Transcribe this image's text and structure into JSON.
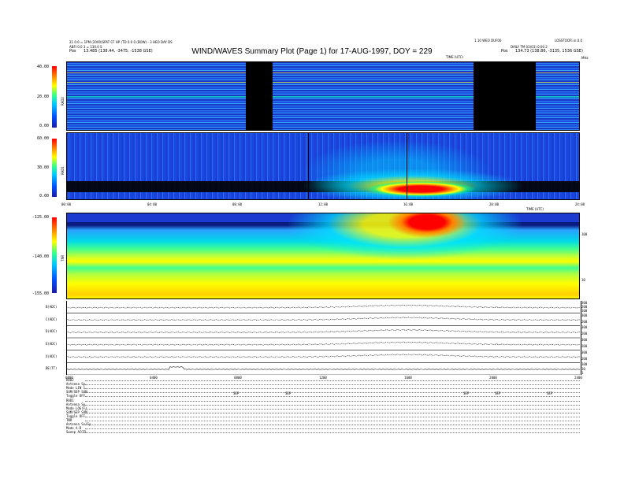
{
  "header": {
    "left_line1": "21 0.0 = 1PM (2000)SPAT CF HP (TD 0.0 0 (BOW) - 3 HEO DAY DS",
    "left_line2": "ABFI 0.0 3 = 130.0 S",
    "left_pos_label": "Pos",
    "left_pos_value": "13.485 (138.44, -3475, -1538 GSE)",
    "right_line1": "1.10 WEO DUF00",
    "right_line2": "LOSSTOOFI.in.0.0",
    "right_line3": "DAILY TM 03(03) 0.00 2",
    "right_pos_label": "Pos",
    "right_pos_value": "134.73 (138.86, -3135, 1536 GSE)",
    "title": "WIND/WAVES Summary Plot (Page 1) for 17-AUG-1997, DOY = 229",
    "mhz_label": "MHz",
    "vsmall_label": "TIME (UTC)"
  },
  "panels": {
    "rad2": {
      "name": "RAD2",
      "ticks": [
        "40.00",
        "20.00",
        "0.00"
      ]
    },
    "rad1": {
      "name": "RAD1",
      "ticks": [
        "60.00",
        "30.00",
        "0.00"
      ]
    },
    "tnr": {
      "name": "TNR",
      "ticks": [
        "-125.00",
        "-140.00",
        "-155.00"
      ],
      "right_ticks": [
        "100",
        "10"
      ]
    },
    "time_ticks": [
      "00:00",
      "04:00",
      "08:00",
      "12:00",
      "16:00",
      "20:00",
      "24:00"
    ],
    "time_ticks_small": [
      "0000",
      "0400",
      "0800",
      "1200",
      "1600",
      "2000",
      "2400"
    ]
  },
  "line_panels": [
    {
      "name": "B(ADC)",
      "right": [
        "300",
        "200",
        "100"
      ]
    },
    {
      "name": "C(ADC)",
      "right": [
        "300",
        "200"
      ]
    },
    {
      "name": "D(ADC)",
      "right": [
        "300",
        "200"
      ]
    },
    {
      "name": "E(ADC)",
      "right": [
        "300",
        "200"
      ]
    },
    {
      "name": "X(ADC)",
      "right": [
        "300",
        "200"
      ]
    },
    {
      "name": "BE(TT)",
      "right": [
        "100",
        "10",
        "1"
      ]
    }
  ],
  "status": {
    "rad2_title": "RAD2",
    "rad2_rows": [
      [
        "Antenna",
        "Sp"
      ],
      [
        "Mode",
        "LIN 1"
      ],
      [
        "SUM/SEP",
        "SUM"
      ],
      [
        "Toggle",
        "OFF"
      ]
    ],
    "rad1_title": "RAD1",
    "rad1_rows": [
      [
        "Antenna",
        "Sp"
      ],
      [
        "Mode",
        "LOG(F)"
      ],
      [
        "SUM/SEP",
        "SUM"
      ],
      [
        "Toggle",
        "OFF"
      ]
    ],
    "tnr_title": "TNR",
    "tnr_rows": [
      [
        "Antenna",
        "Sx/Sy"
      ],
      [
        "Mode",
        "A-D"
      ],
      [
        "Sweep",
        "ACCEL"
      ]
    ],
    "event_labels": [
      "SEP",
      "SEP",
      "SEP",
      "SEP",
      "SEP"
    ]
  },
  "chart_data": [
    {
      "type": "heatmap",
      "title": "RAD2",
      "ylabel": "RAD2",
      "ylim": [
        0,
        40
      ],
      "xlim_hours": [
        0,
        24
      ],
      "data_gaps_hours": [
        [
          6.2,
          7.4
        ],
        [
          18.0,
          20.6
        ]
      ],
      "colormap": [
        "#1a1aa6",
        "#0050ff",
        "#00c8ff",
        "#30ff90",
        "#ffff00",
        "#ff8000",
        "#ff0000"
      ]
    },
    {
      "type": "heatmap",
      "title": "RAD1",
      "ylabel": "RAD1",
      "ylim": [
        0,
        60
      ],
      "xlim_hours": [
        0,
        24
      ],
      "intensity_profile": {
        "x_hours": [
          0,
          4,
          8,
          10,
          12,
          14,
          15,
          16,
          17,
          18,
          19,
          20,
          24
        ],
        "level": [
          0.15,
          0.1,
          0.2,
          0.4,
          0.5,
          0.6,
          0.75,
          0.95,
          0.9,
          0.6,
          0.35,
          0.2,
          0.15
        ]
      }
    },
    {
      "type": "heatmap",
      "title": "TNR",
      "ylabel": "TNR",
      "ylim": [
        -155,
        -125
      ],
      "xlim_hours": [
        0,
        24
      ],
      "intensity_profile": {
        "x_hours": [
          0,
          4,
          8,
          10,
          12,
          14,
          15,
          16,
          17,
          18,
          20,
          24
        ],
        "level": [
          0.3,
          0.3,
          0.4,
          0.55,
          0.6,
          0.7,
          0.9,
          0.95,
          0.95,
          0.7,
          0.4,
          0.35
        ]
      }
    }
  ]
}
